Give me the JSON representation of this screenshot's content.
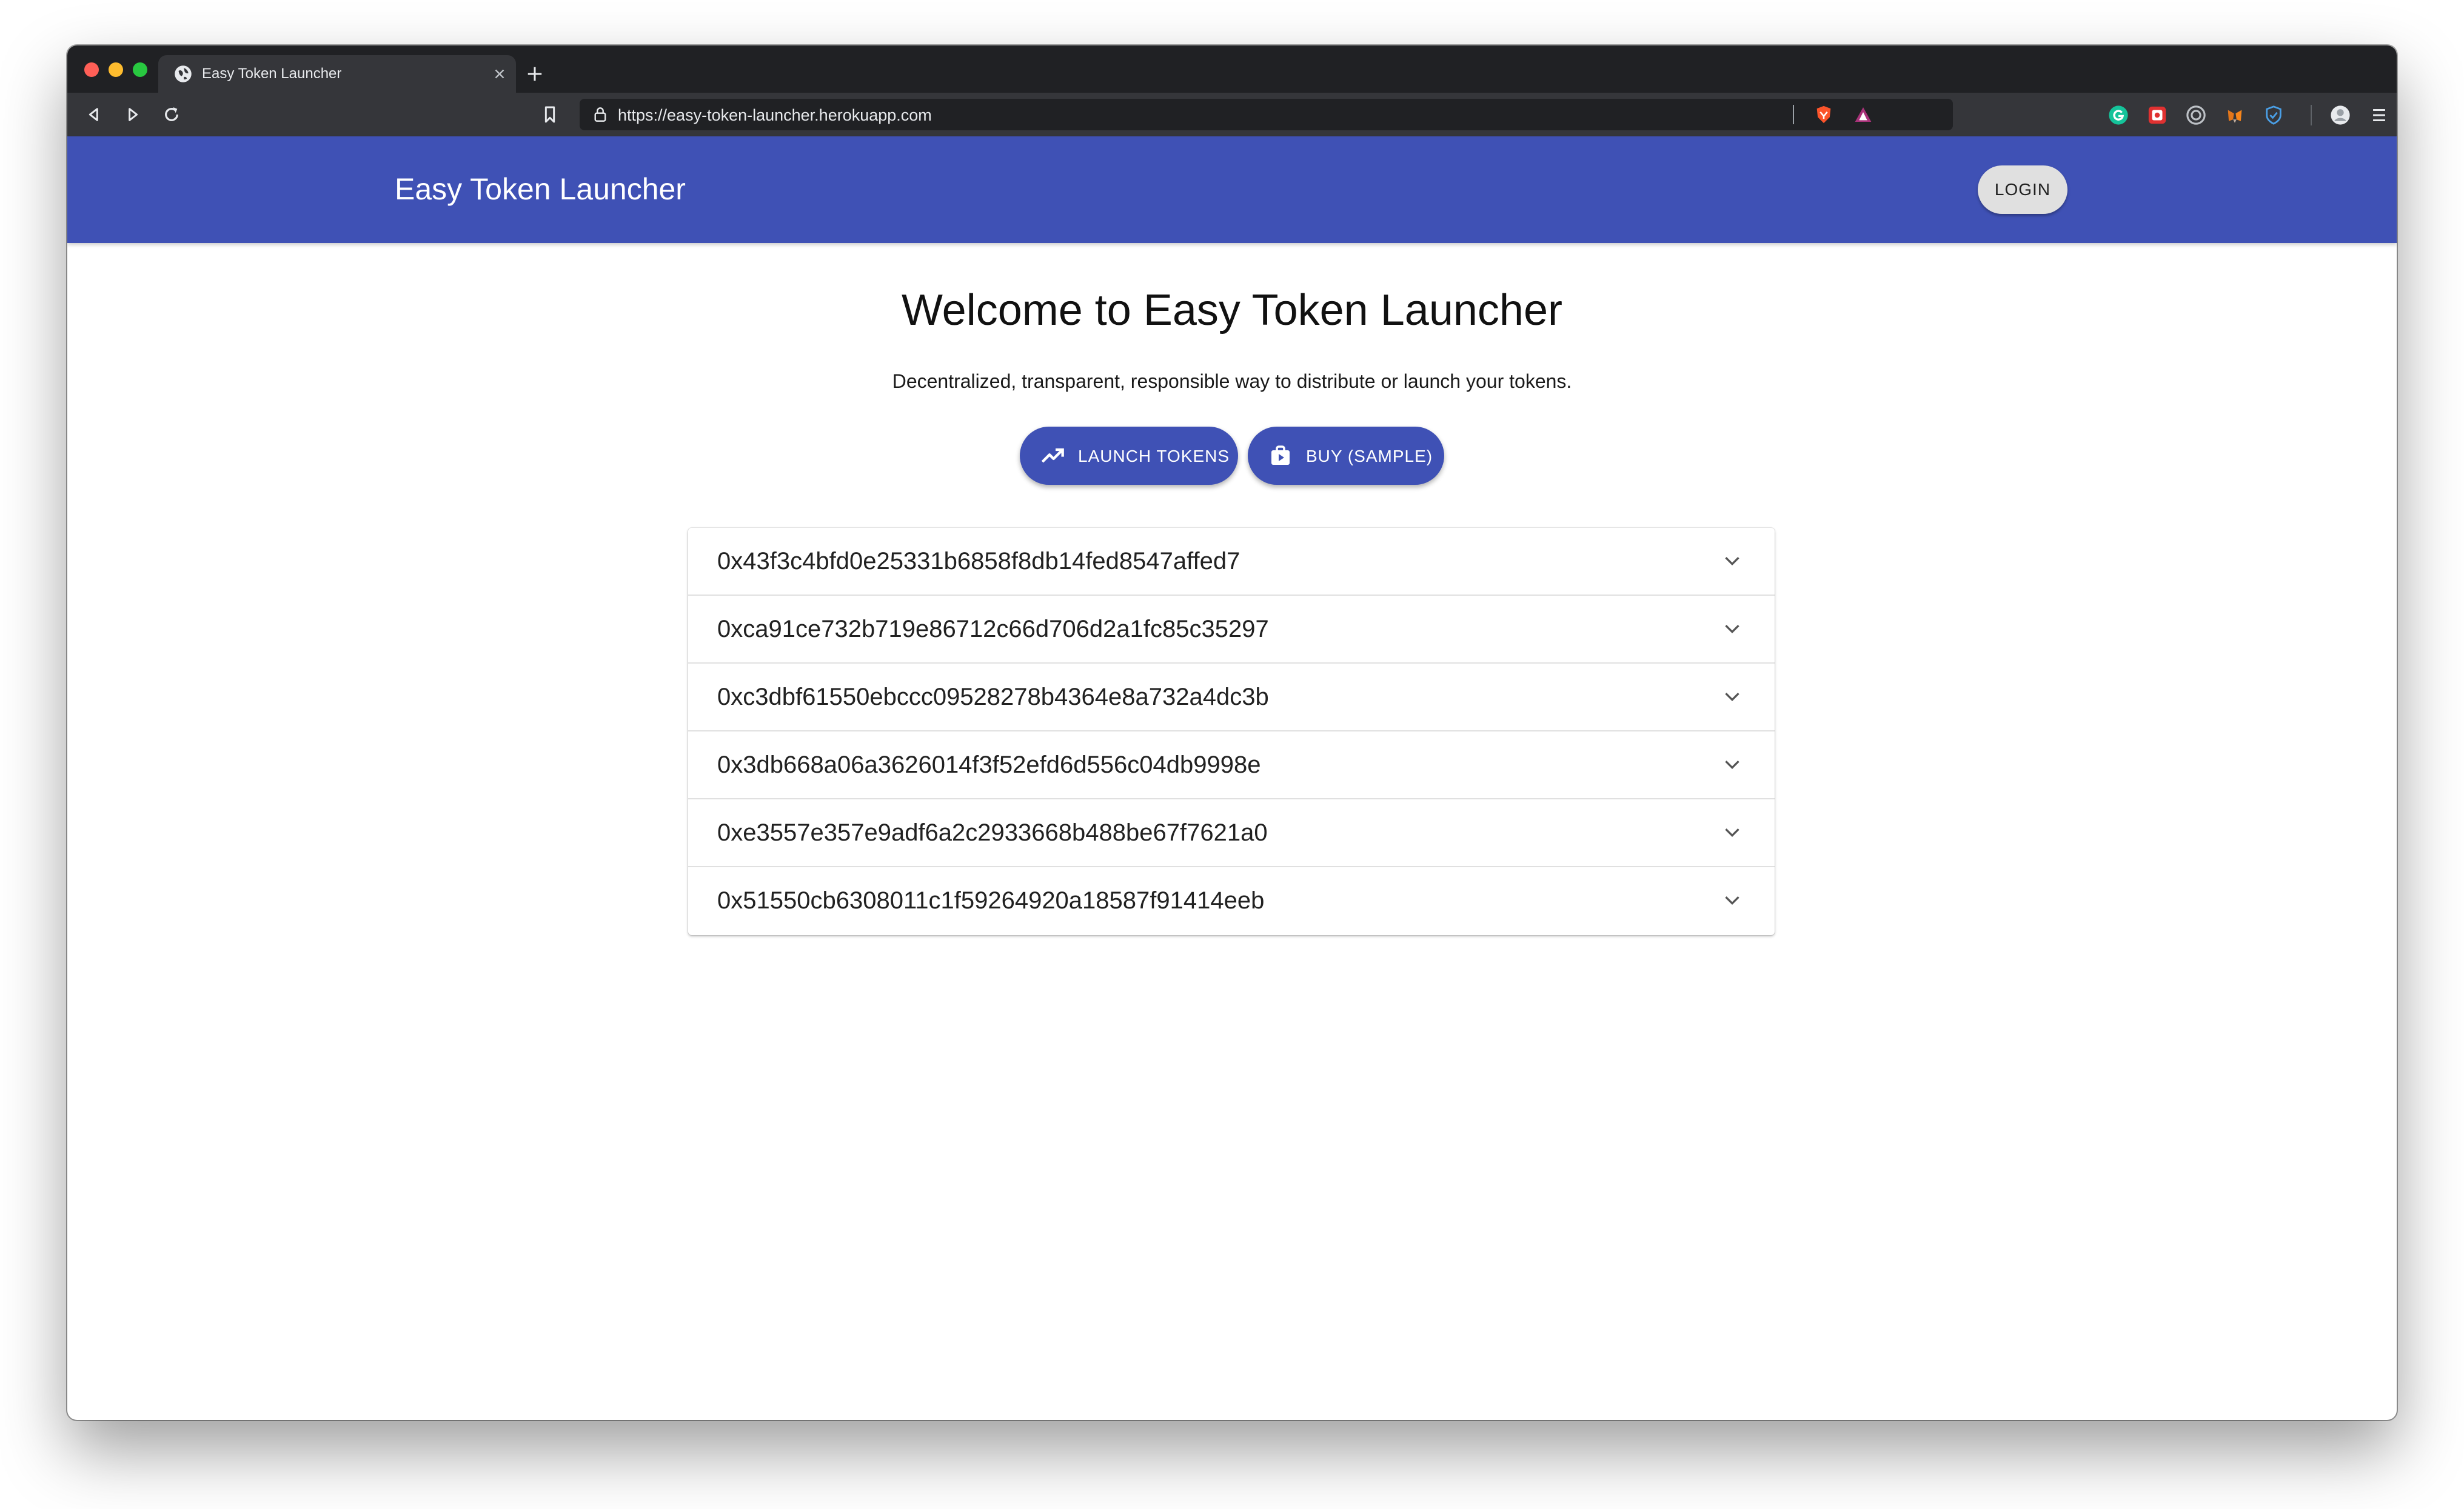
{
  "browser": {
    "tab_title": "Easy Token Launcher",
    "url": "https://easy-token-launcher.herokuapp.com",
    "extensions": [
      "grammarly-icon",
      "ext-red-icon",
      "ext-target-icon",
      "metamask-icon",
      "shield-icon",
      "profile-avatar",
      "menu-icon"
    ]
  },
  "app": {
    "title": "Easy Token Launcher",
    "login_label": "LOGIN",
    "brand_color": "#3f51b5"
  },
  "hero": {
    "heading": "Welcome to Easy Token Launcher",
    "subtitle": "Decentralized, transparent, responsible way to distribute or launch your tokens.",
    "launch_label": "LAUNCH TOKENS",
    "buy_label": "BUY (SAMPLE)"
  },
  "tokens": [
    "0x43f3c4bfd0e25331b6858f8db14fed8547affed7",
    "0xca91ce732b719e86712c66d706d2a1fc85c35297",
    "0xc3dbf61550ebccc09528278b4364e8a732a4dc3b",
    "0x3db668a06a3626014f3f52efd6d556c04db9998e",
    "0xe3557e357e9adf6a2c2933668b488be67f7621a0",
    "0x51550cb6308011c1f59264920a18587f91414eeb"
  ]
}
